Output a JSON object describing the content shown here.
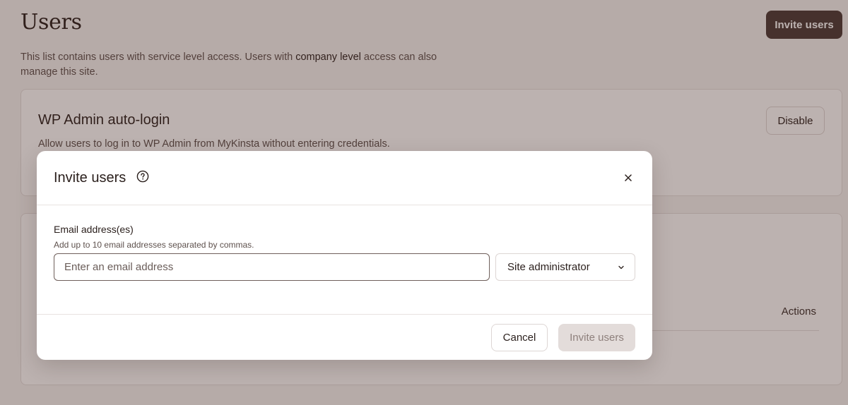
{
  "page": {
    "title": "Users",
    "invite_button_label": "Invite users",
    "description_prefix": "This list contains users with service level access. Users with ",
    "description_strong": "company level",
    "description_suffix": " access can also manage this site."
  },
  "autologin_card": {
    "title": "WP Admin auto-login",
    "description": "Allow users to log in to WP Admin from MyKinsta without entering credentials.",
    "disable_label": "Disable"
  },
  "users_card": {
    "actions_column": "Actions"
  },
  "modal": {
    "title": "Invite users",
    "help_icon": "question-circle-icon",
    "close_icon": "close-icon",
    "email_label": "Email address(es)",
    "email_help": "Add up to 10 email addresses separated by commas.",
    "email_value": "",
    "email_placeholder": "Enter an email address",
    "role_selected": "Site administrator",
    "cancel_label": "Cancel",
    "submit_label": "Invite users"
  },
  "colors": {
    "primary_button": "#4a3a36",
    "overlay": "#3e221c",
    "disabled_button": "#e3dcda"
  }
}
